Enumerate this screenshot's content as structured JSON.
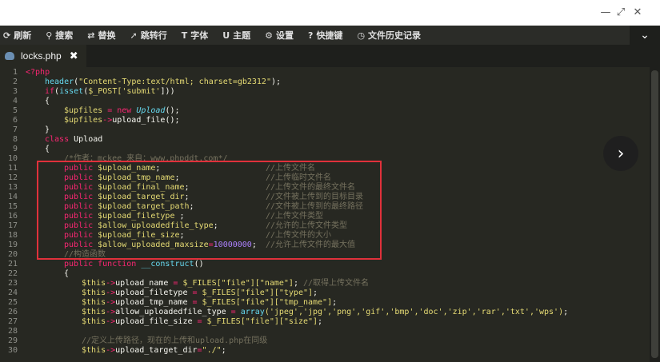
{
  "window": {
    "minimize": "—",
    "maximize": "⤢",
    "close": "✕"
  },
  "toolbar": {
    "items": [
      {
        "label": "刷新",
        "icon": "⟳"
      },
      {
        "label": "搜索",
        "icon": "⚲"
      },
      {
        "label": "替换",
        "icon": "⇄"
      },
      {
        "label": "跳转行",
        "icon": "➚"
      },
      {
        "label": "字体",
        "icon": "T"
      },
      {
        "label": "主题",
        "icon": "U"
      },
      {
        "label": "设置",
        "icon": "⚙"
      },
      {
        "label": "快捷键",
        "icon": "?"
      },
      {
        "label": "文件历史记录",
        "icon": "◷"
      }
    ],
    "collapse_icon": "⌄"
  },
  "tab": {
    "label": "locks.php",
    "close": "✖"
  },
  "line_numbers": [
    "1",
    "2",
    "3",
    "4",
    "5",
    "6",
    "7",
    "8",
    "9",
    "10",
    "11",
    "12",
    "13",
    "14",
    "15",
    "16",
    "17",
    "18",
    "19",
    "20",
    "21",
    "22",
    "23",
    "24",
    "25",
    "26",
    "27",
    "28",
    "29",
    "30"
  ],
  "code": {
    "l1": "<?php",
    "l2a": "header",
    "l2b": "(",
    "l2c": "\"Content-Type:text/html; charset=gb2312\"",
    "l2d": ");",
    "l3a": "if",
    "l3b": "(",
    "l3c": "isset",
    "l3d": "(",
    "l3e": "$_POST",
    "l3f": "['submit'",
    "l3g": "]))",
    "l4": "{",
    "l5a": "$upfiles",
    "l5b": " = ",
    "l5c": "new",
    "l5d": " Upload",
    "l5e": "();",
    "l6a": "$upfiles",
    "l6b": "->",
    "l6c": "upload_file",
    "l6d": "();",
    "l7": "}",
    "l8a": "class",
    "l8b": " Upload",
    "l9": "{",
    "l10": "/*作者：mckee 来自：www.phpddt.com*/",
    "l11a": "public",
    "l11b": " $upload_name",
    "l11c": ";",
    "l11d": "//上传文件名",
    "l12a": "public",
    "l12b": " $upload_tmp_name",
    "l12c": ";",
    "l12d": "//上传临时文件名",
    "l13a": "public",
    "l13b": " $upload_final_name",
    "l13c": ";",
    "l13d": "//上传文件的最终文件名",
    "l14a": "public",
    "l14b": " $upload_target_dir",
    "l14c": ";",
    "l14d": "//文件被上传到的目标目录",
    "l15a": "public",
    "l15b": " $upload_target_path",
    "l15c": ";",
    "l15d": "//文件被上传到的最终路径",
    "l16a": "public",
    "l16b": " $upload_filetype",
    "l16c": " ;",
    "l16d": "//上传文件类型",
    "l17a": "public",
    "l17b": " $allow_uploadedfile_type",
    "l17c": ";",
    "l17d": "//允许的上传文件类型",
    "l18a": "public",
    "l18b": " $upload_file_size",
    "l18c": ";",
    "l18d": "//上传文件的大小",
    "l19a": "public",
    "l19b": " $allow_uploaded_maxsize",
    "l19c": "=",
    "l19d": "10000000",
    "l19e": ";",
    "l19f": "//允许上传文件的最大值",
    "l20": "//构造函数",
    "l21a": "public",
    "l21b": " function",
    "l21c": " __construct",
    "l21d": "()",
    "l22": "{",
    "l23a": "$this",
    "l23b": "->",
    "l23c": "upload_name",
    "l23d": " = ",
    "l23e": "$_FILES",
    "l23f": "[\"file\"][\"name\"]",
    "l23g": ";",
    "l23h": " //取得上传文件名",
    "l24a": "$this",
    "l24b": "->",
    "l24c": "upload_filetype",
    "l24d": " = ",
    "l24e": "$_FILES",
    "l24f": "[\"file\"][\"type\"]",
    "l24g": ";",
    "l25a": "$this",
    "l25b": "->",
    "l25c": "upload_tmp_name",
    "l25d": " = ",
    "l25e": "$_FILES",
    "l25f": "[\"file\"][\"tmp_name\"]",
    "l25g": ";",
    "l26a": "$this",
    "l26b": "->",
    "l26c": "allow_uploadedfile_type",
    "l26d": " = ",
    "l26e": "array",
    "l26f": "('jpeg','jpg','png','gif','bmp','doc','zip','rar','txt','wps')",
    "l26g": ";",
    "l27a": "$this",
    "l27b": "->",
    "l27c": "upload_file_size",
    "l27d": " = ",
    "l27e": "$_FILES",
    "l27f": "[\"file\"][\"size\"]",
    "l27g": ";",
    "l28": "",
    "l29": "//定义上传路径，现在的上传和upload.php在同级",
    "l30a": "$this",
    "l30b": "->",
    "l30c": "upload_target_dir",
    "l30d": "=",
    "l30e": "\"./\"",
    "l30f": ";"
  },
  "next_button": "›"
}
